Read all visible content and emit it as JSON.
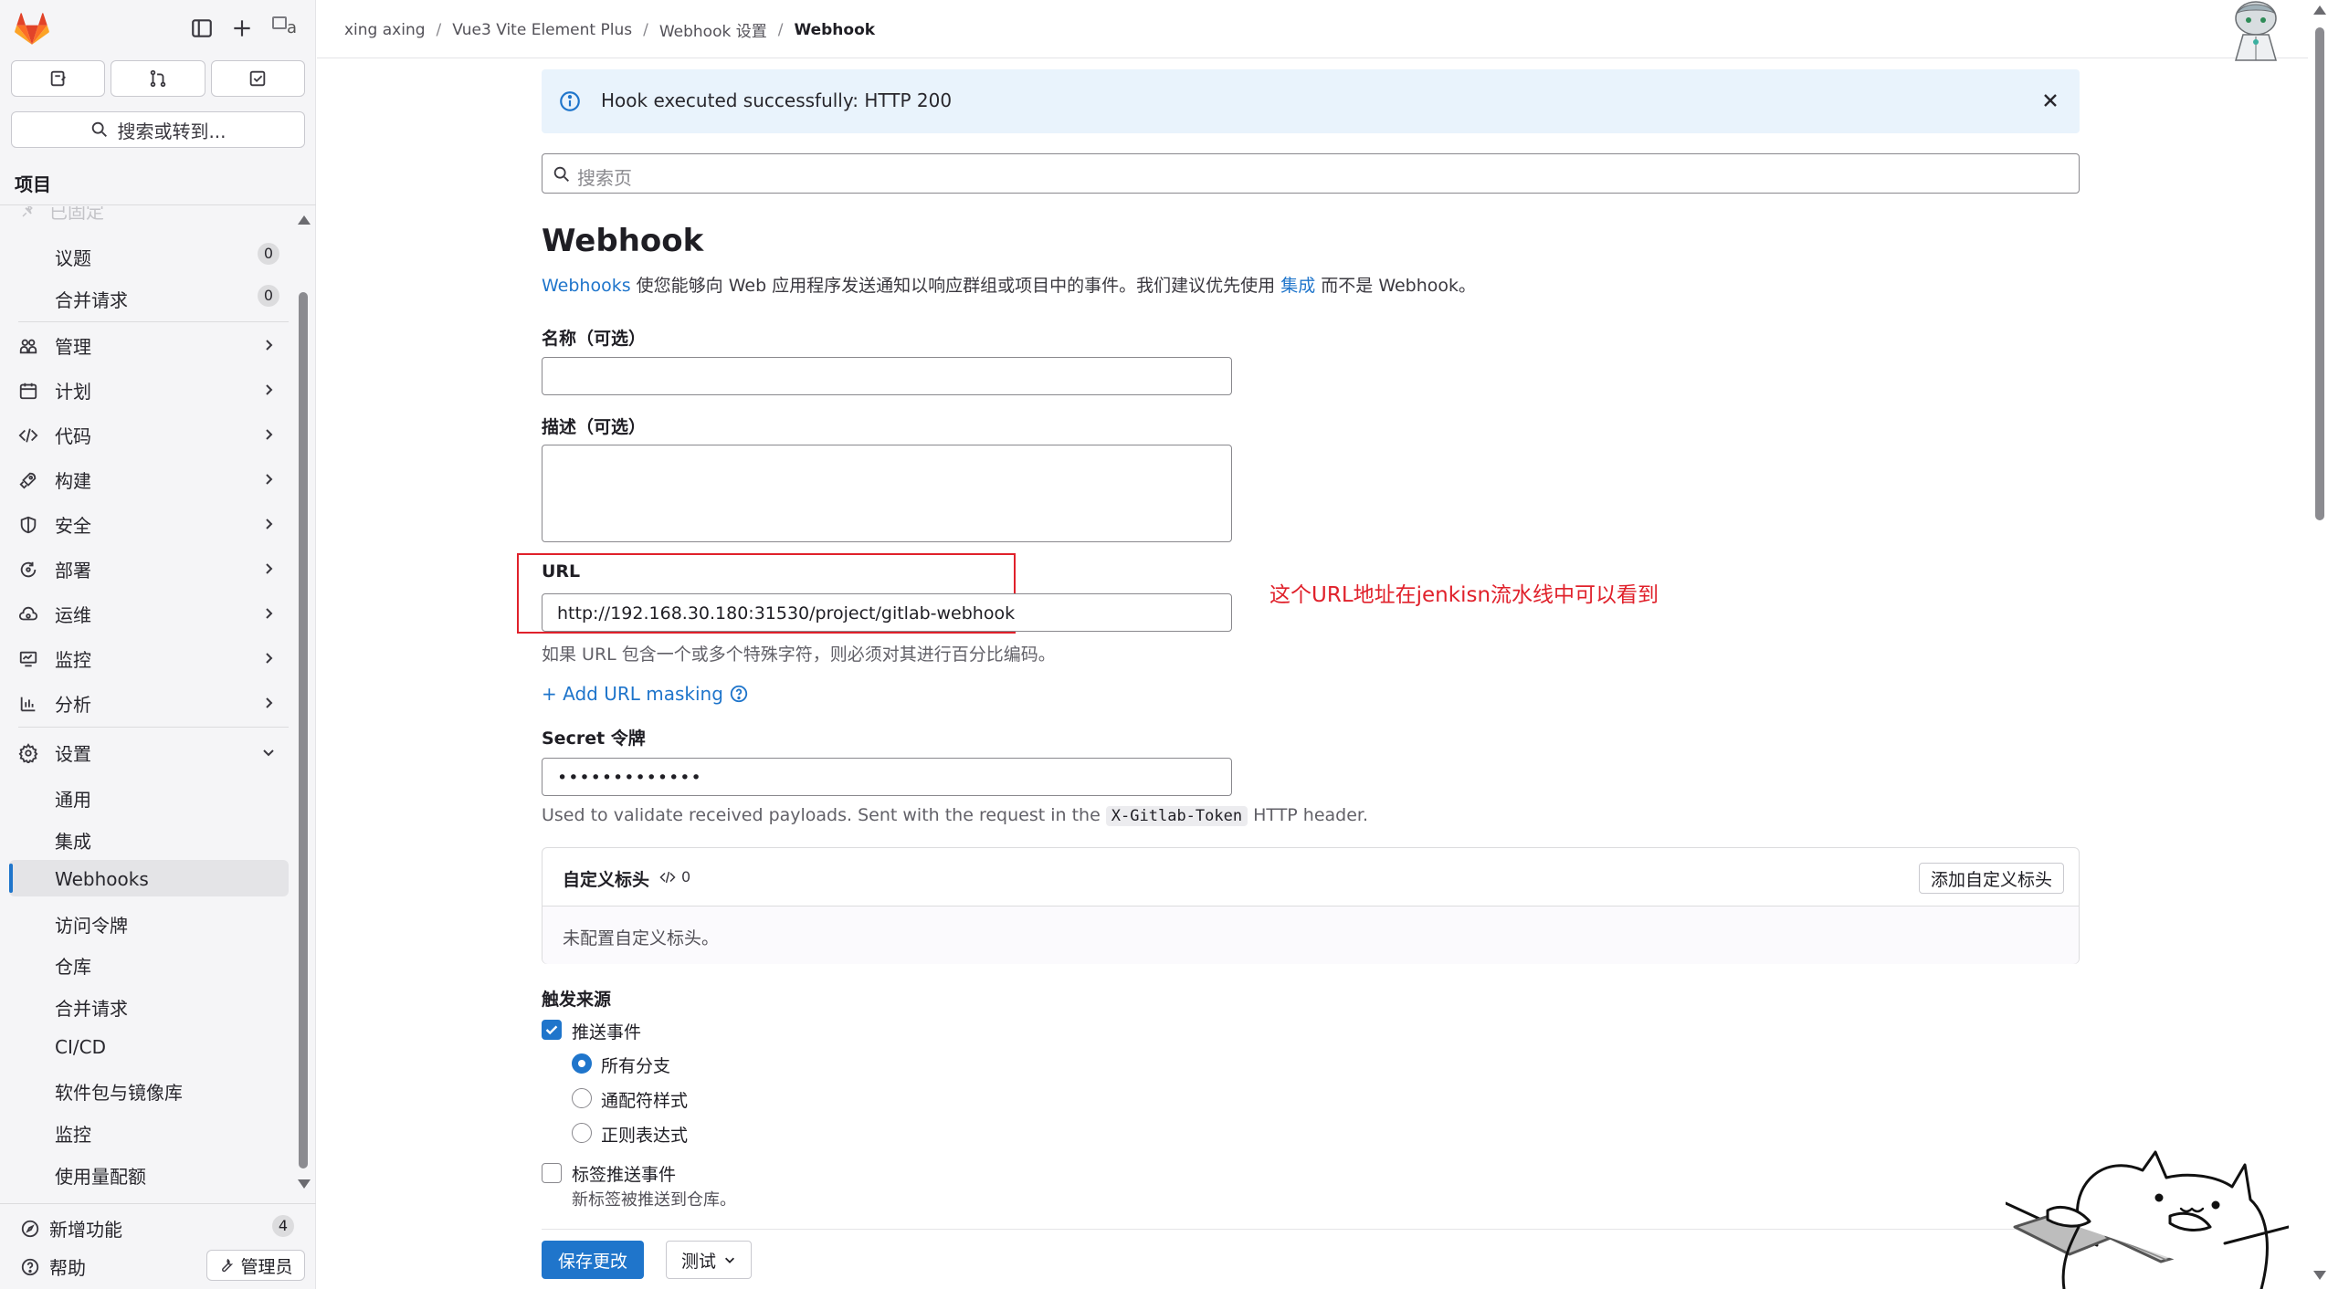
{
  "sidebar": {
    "search_label": "搜索或转到...",
    "context_title": "项目",
    "faded_item": "已固定",
    "pinned": [
      {
        "label": "议题",
        "count": "0"
      },
      {
        "label": "合并请求",
        "count": "0"
      }
    ],
    "nav": [
      {
        "label": "管理",
        "icon": "users-icon"
      },
      {
        "label": "计划",
        "icon": "calendar-icon"
      },
      {
        "label": "代码",
        "icon": "code-icon"
      },
      {
        "label": "构建",
        "icon": "rocket-icon"
      },
      {
        "label": "安全",
        "icon": "shield-icon"
      },
      {
        "label": "部署",
        "icon": "deployments-icon"
      },
      {
        "label": "运维",
        "icon": "cloud-gear-icon"
      },
      {
        "label": "监控",
        "icon": "monitor-icon"
      },
      {
        "label": "分析",
        "icon": "chart-icon"
      }
    ],
    "settings": {
      "label": "设置",
      "items": [
        "通用",
        "集成",
        "Webhooks",
        "访问令牌",
        "仓库",
        "合并请求",
        "CI/CD",
        "软件包与镜像库",
        "监控",
        "使用量配额"
      ],
      "active": "Webhooks"
    },
    "whats_new": {
      "label": "新增功能",
      "count": "4"
    },
    "help": "帮助",
    "admin": "管理员",
    "avatar_alt": "a"
  },
  "breadcrumb": [
    "xing axing",
    "Vue3 Vite Element Plus",
    "Webhook 设置",
    "Webhook"
  ],
  "alert": {
    "message": "Hook executed successfully: HTTP 200"
  },
  "page_search": {
    "placeholder": "搜索页"
  },
  "page": {
    "title": "Webhook",
    "desc_link1": "Webhooks",
    "desc_mid": " 使您能够向 Web 应用程序发送通知以响应群组或项目中的事件。我们建议优先使用 ",
    "desc_link2": "集成",
    "desc_end": " 而不是 Webhook。"
  },
  "form": {
    "name_label": "名称（可选）",
    "name_value": "",
    "desc_label": "描述（可选）",
    "desc_value": "",
    "url_label": "URL",
    "url_value": "http://192.168.30.180:31530/project/gitlab-webhook",
    "url_help": "如果 URL 包含一个或多个特殊字符，则必须对其进行百分比编码。",
    "add_masking": "+ Add URL masking",
    "secret_label": "Secret 令牌",
    "secret_value": "•••••••••••••",
    "secret_help_pre": "Used to validate received payloads. Sent with the request in the ",
    "secret_help_code": "X-Gitlab-Token",
    "secret_help_post": " HTTP header."
  },
  "annotation": "这个URL地址在jenkisn流水线中可以看到",
  "custom_headers": {
    "title": "自定义标头",
    "count": "0",
    "add_button": "添加自定义标头",
    "empty_text": "未配置自定义标头。"
  },
  "triggers": {
    "section_label": "触发来源",
    "push_events": {
      "label": "推送事件",
      "checked": true
    },
    "branch_options": [
      {
        "label": "所有分支",
        "selected": true
      },
      {
        "label": "通配符样式",
        "selected": false
      },
      {
        "label": "正则表达式",
        "selected": false
      }
    ],
    "tag_push": {
      "label": "标签推送事件",
      "sub": "新标签被推送到仓库。",
      "checked": false
    }
  },
  "footer": {
    "save": "保存更改",
    "test": "测试"
  },
  "colors": {
    "accent": "#1f75cb",
    "annotation_red": "#e0212b",
    "alert_bg": "#e9f3fc"
  }
}
